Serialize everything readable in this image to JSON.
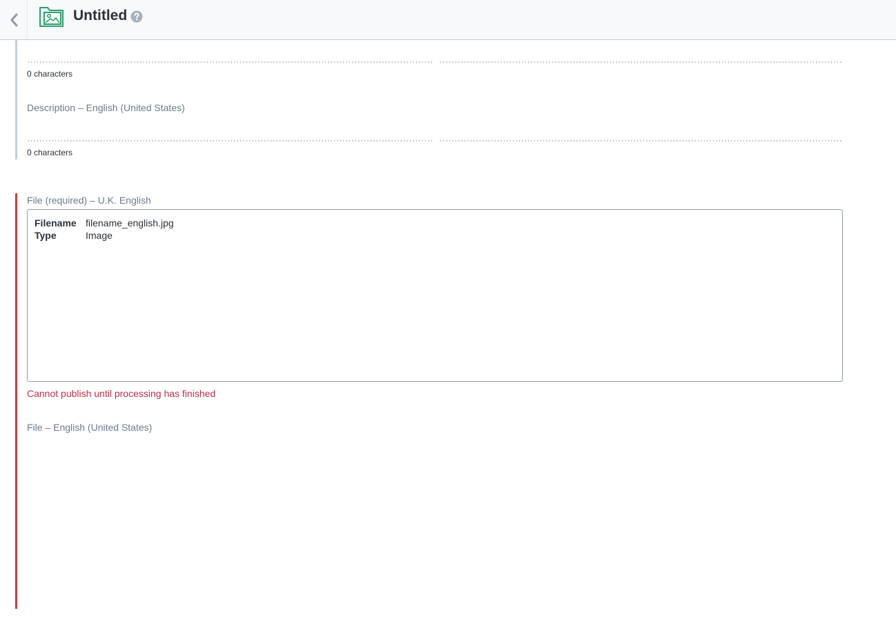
{
  "header": {
    "title": "Untitled",
    "back_icon": "chevron-left-icon",
    "entry_type_icon": "asset-image-icon",
    "help_icon": "question-circle-icon"
  },
  "title_field": {
    "char_count": "0 characters"
  },
  "description_field": {
    "label": "Description – English (United States)",
    "char_count": "0 characters"
  },
  "file_field_uk": {
    "label": "File (required) – U.K. English",
    "meta": [
      {
        "key": "Filename",
        "value": "filename_english.jpg"
      },
      {
        "key": "Type",
        "value": "Image"
      }
    ],
    "error": "Cannot publish until processing has finished"
  },
  "file_field_us": {
    "label": "File – English (United States)"
  },
  "colors": {
    "accent_green": "#2e9e6e",
    "error_red": "#d3393a",
    "label_grey": "#6a7a8c"
  }
}
